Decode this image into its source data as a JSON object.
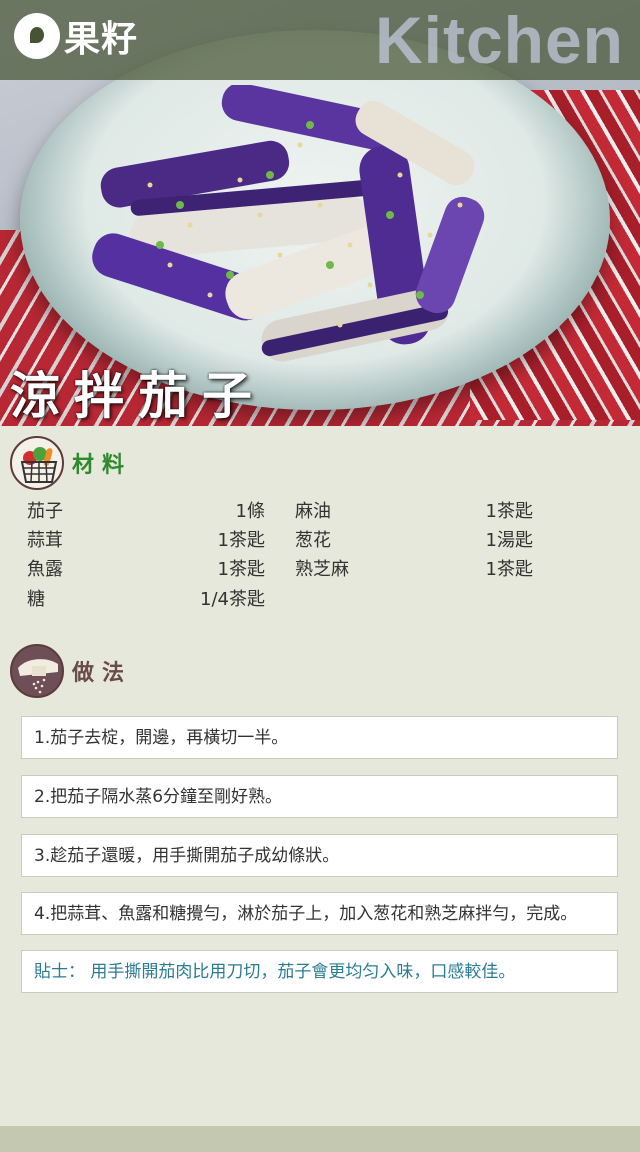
{
  "header": {
    "logo_text": "果籽",
    "section_badge": "Kitchen"
  },
  "dish": {
    "title": "涼拌茄子"
  },
  "ingredients_section": {
    "title": "材料",
    "icon": "vegetable-basket-icon",
    "items": [
      {
        "name": "茄子",
        "qty": "1條"
      },
      {
        "name": "蒜茸",
        "qty": "1茶匙"
      },
      {
        "name": "魚露",
        "qty": "1茶匙"
      },
      {
        "name": "糖",
        "qty": "1/4茶匙"
      },
      {
        "name": "麻油",
        "qty": "1茶匙"
      },
      {
        "name": "葱花",
        "qty": "1湯匙"
      },
      {
        "name": "熟芝麻",
        "qty": "1茶匙"
      }
    ]
  },
  "method_section": {
    "title": "做法",
    "icon": "salt-shaker-icon",
    "steps": [
      "1.茄子去椗，開邊，再橫切一半。",
      "2.把茄子隔水蒸6分鐘至剛好熟。",
      "3.趁茄子還暖，用手撕開茄子成幼條狀。",
      "4.把蒜茸、魚露和糖攪勻，淋於茄子上，加入葱花和熟芝麻拌勻，完成。"
    ],
    "tip": "貼士： 用手撕開茄肉比用刀切，茄子會更均匀入味，口感較佳。"
  },
  "colors": {
    "background": "#e6e8db",
    "ingredients_title": "#2e8a2e",
    "method_title": "#6b4a4a",
    "tip_text": "#2a7c92",
    "header_bar": "#465434"
  }
}
